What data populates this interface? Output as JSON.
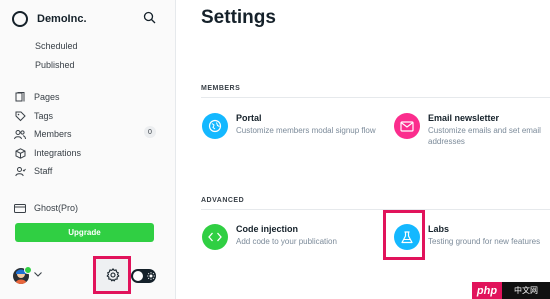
{
  "sidebar": {
    "brand": "DemoInc.",
    "sub_items": [
      "Scheduled",
      "Published"
    ],
    "nav": [
      {
        "label": "Pages",
        "icon": "pages-icon"
      },
      {
        "label": "Tags",
        "icon": "tag-icon"
      },
      {
        "label": "Members",
        "icon": "members-icon",
        "badge": "0"
      },
      {
        "label": "Integrations",
        "icon": "integrations-icon"
      },
      {
        "label": "Staff",
        "icon": "staff-icon"
      }
    ],
    "plan": "Ghost(Pro)",
    "upgrade": "Upgrade"
  },
  "main": {
    "title": "Settings",
    "sections": [
      {
        "heading": "MEMBERS",
        "cards": [
          {
            "title": "Portal",
            "desc": "Customize members modal signup flow",
            "icon": "portal-icon",
            "color": "#14b8ff"
          },
          {
            "title": "Email newsletter",
            "desc": "Customize emails and set email",
            "desc2": "addresses",
            "icon": "envelope-icon",
            "color": "#fb2d8d"
          }
        ]
      },
      {
        "heading": "ADVANCED",
        "cards": [
          {
            "title": "Code injection",
            "desc": "Add code to your publication",
            "icon": "code-icon",
            "color": "#30cf43"
          },
          {
            "title": "Labs",
            "desc": "Testing ground for new features",
            "icon": "flask-icon",
            "color": "#14b8ff"
          }
        ]
      }
    ]
  },
  "watermark": {
    "left": "php",
    "right": "中文网"
  },
  "colors": {
    "highlight": "#e1135b",
    "accent": "#30cf43"
  }
}
